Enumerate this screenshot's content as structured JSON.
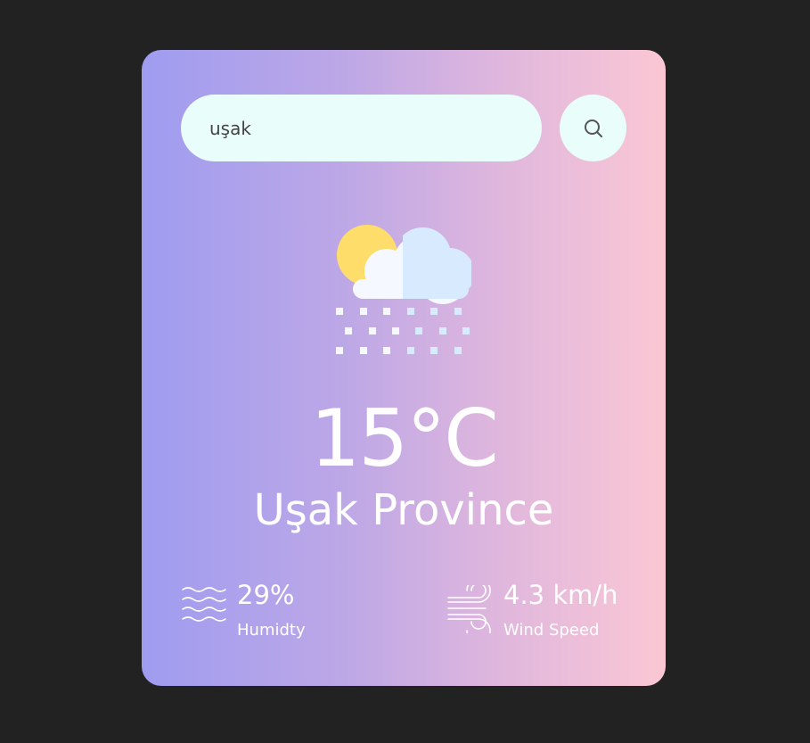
{
  "search": {
    "value": "uşak",
    "button_icon": "search-icon"
  },
  "weather": {
    "icon": "partly-cloudy-snow-icon",
    "temperature": "15°C",
    "city": "Uşak Province"
  },
  "stats": {
    "humidity": {
      "icon": "humidity-waves-icon",
      "value": "29%",
      "label": "Humidty"
    },
    "wind": {
      "icon": "wind-icon",
      "value": "4.3 km/h",
      "label": "Wind Speed"
    }
  },
  "colors": {
    "page_background": "#222222",
    "card_gradient_start": "#9f9cf0",
    "card_gradient_end": "#fbc7d4",
    "search_background": "#e9fdfb",
    "text": "#ffffff"
  }
}
